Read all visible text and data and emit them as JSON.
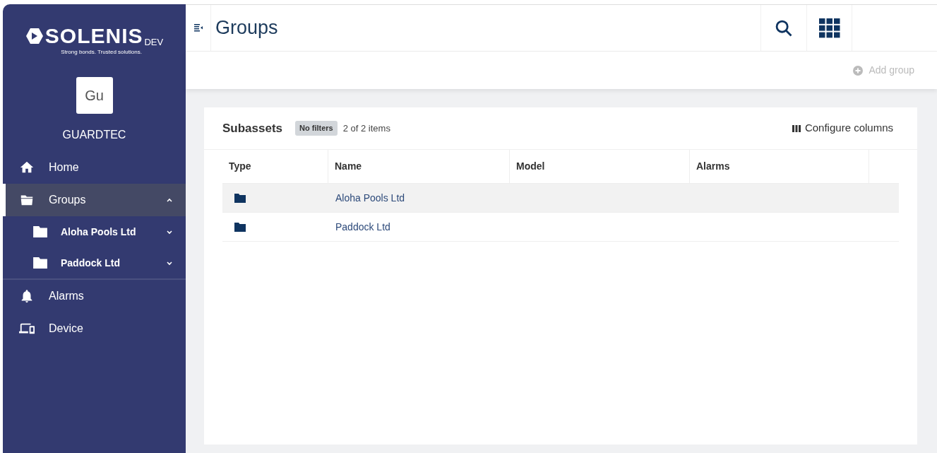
{
  "logo": {
    "wordmark": "SOLENIS",
    "env": "DEV",
    "tagline": "Strong bonds. Trusted solutions."
  },
  "account": {
    "initials": "Gu",
    "name": "GUARDTEC"
  },
  "sidebar": {
    "items": [
      {
        "label": "Home",
        "kind": "home",
        "selected": false
      },
      {
        "label": "Groups",
        "kind": "groups",
        "selected": true,
        "expanded": true,
        "children": [
          {
            "label": "Aloha Pools Ltd",
            "kind": "folder",
            "expanded": false
          },
          {
            "label": "Paddock Ltd",
            "kind": "folder",
            "expanded": false
          }
        ]
      },
      {
        "label": "Alarms",
        "kind": "alarms",
        "selected": false
      },
      {
        "label": "Device",
        "kind": "device",
        "selected": false
      }
    ]
  },
  "header": {
    "title": "Groups"
  },
  "toolbar": {
    "add_button": "Add group",
    "add_disabled": true
  },
  "panel": {
    "title": "Subassets",
    "filter_badge": "No filters",
    "count": "2 of 2 items",
    "configure_button": "Configure columns",
    "table": {
      "columns": [
        "Type",
        "Name",
        "Model",
        "Alarms"
      ],
      "rows": [
        {
          "kind": "folder",
          "name": "Aloha Pools Ltd",
          "selected": true
        },
        {
          "kind": "folder",
          "name": "Paddock Ltd",
          "selected": false
        }
      ]
    }
  }
}
